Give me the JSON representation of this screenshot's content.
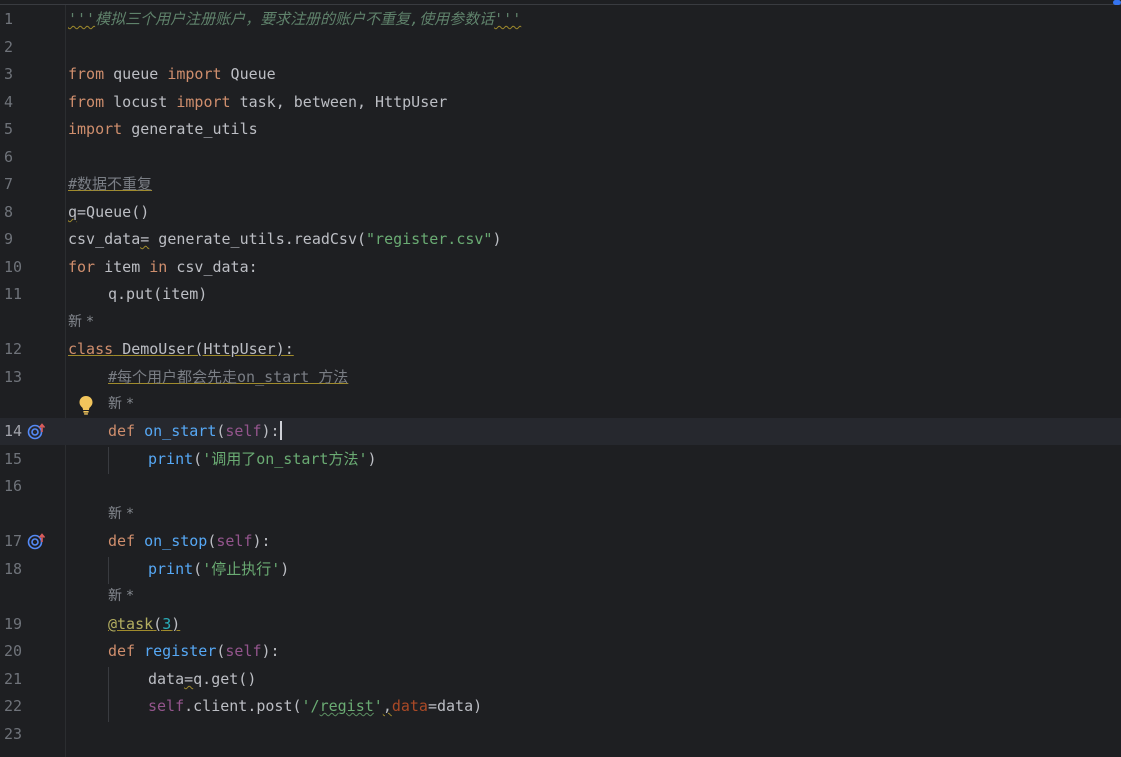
{
  "editor": {
    "lines": [
      {
        "n": "1",
        "parts": [
          "'''",
          "模拟三个用户注册账户，要求注册的账户不重复,使用参数话",
          "'''"
        ]
      },
      {
        "n": "2"
      },
      {
        "n": "3",
        "parts": [
          "from",
          " queue ",
          "import",
          " Queue"
        ]
      },
      {
        "n": "4",
        "parts": [
          "from",
          " locust ",
          "import",
          " task, between, HttpUser"
        ]
      },
      {
        "n": "5",
        "parts": [
          "import",
          " generate_utils"
        ]
      },
      {
        "n": "6"
      },
      {
        "n": "7",
        "parts": [
          "#数据不重复"
        ]
      },
      {
        "n": "8",
        "parts": [
          "q",
          "=Queue()"
        ]
      },
      {
        "n": "9",
        "parts": [
          "csv_data",
          "=",
          " generate_utils.readCsv(",
          "\"register.csv\"",
          ")"
        ]
      },
      {
        "n": "10",
        "parts": [
          "for",
          " item ",
          "in",
          " csv_data:"
        ]
      },
      {
        "n": "11",
        "parts": [
          "q.put(item)"
        ]
      },
      {
        "hint": "新 *"
      },
      {
        "n": "12",
        "parts": [
          "class",
          " ",
          "DemoUser(HttpUser):"
        ]
      },
      {
        "n": "13",
        "parts": [
          "#每个用户都会先走on_start 方法"
        ]
      },
      {
        "hint": "新 *"
      },
      {
        "n": "14",
        "parts": [
          "def",
          " ",
          "on_start",
          "(",
          "self",
          "):"
        ]
      },
      {
        "n": "15",
        "parts": [
          "print",
          "(",
          "'调用了on_start方法'",
          ")"
        ]
      },
      {
        "n": "16"
      },
      {
        "hint": "新 *"
      },
      {
        "n": "17",
        "parts": [
          "def",
          " ",
          "on_stop",
          "(",
          "self",
          "):"
        ]
      },
      {
        "n": "18",
        "parts": [
          "print",
          "(",
          "'停止执行'",
          ")"
        ]
      },
      {
        "hint": "新 *"
      },
      {
        "n": "19",
        "parts": [
          "@task",
          "(",
          "3",
          ")"
        ]
      },
      {
        "n": "20",
        "parts": [
          "def",
          " ",
          "register",
          "(",
          "self",
          "):"
        ]
      },
      {
        "n": "21",
        "parts": [
          "data",
          "=",
          "q.get()"
        ]
      },
      {
        "n": "22",
        "parts": [
          "self",
          ".client.post(",
          "'/",
          "regist",
          "'",
          ",",
          "data",
          "=data)"
        ]
      },
      {
        "n": "23"
      }
    ]
  },
  "colors": {
    "background": "#1e1f22",
    "keyword": "#cf8e6d",
    "string": "#6aab73",
    "function": "#56a8f5",
    "self": "#94558d",
    "comment": "#7a7e85",
    "decorator": "#b3ae60",
    "number": "#2aacb8"
  },
  "icons": {
    "gutter_override": "override-method-icon",
    "intention": "lightbulb-icon"
  }
}
